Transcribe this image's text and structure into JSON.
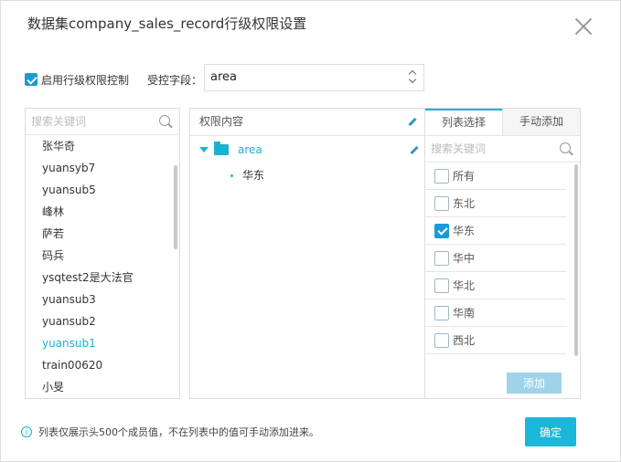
{
  "dialog": {
    "title": "数据集company_sales_record行级权限设置"
  },
  "controls": {
    "enable_label": "启用行级权限控制",
    "enable_checked": true,
    "field_label": "受控字段：",
    "field_value": "area"
  },
  "users": {
    "search_placeholder": "搜索关键词",
    "items": [
      "张华奇",
      "yuansyb7",
      "yuansub5",
      "峰林",
      "萨若",
      "码兵",
      "ysqtest2是大法官",
      "yuansub3",
      "yuansub2",
      "yuansub1",
      "train00620",
      "小旻"
    ],
    "selected": "yuansub1"
  },
  "permissions": {
    "header": "权限内容",
    "tree_root": "area",
    "tree_children": [
      "华东"
    ]
  },
  "selector": {
    "tabs": [
      "列表选择",
      "手动添加"
    ],
    "active_tab": "列表选择",
    "search_placeholder": "搜索关键词",
    "options": [
      {
        "label": "所有",
        "checked": false
      },
      {
        "label": "东北",
        "checked": false
      },
      {
        "label": "华东",
        "checked": true
      },
      {
        "label": "华中",
        "checked": false
      },
      {
        "label": "华北",
        "checked": false
      },
      {
        "label": "华南",
        "checked": false
      },
      {
        "label": "西北",
        "checked": false
      }
    ],
    "add_label": "添加"
  },
  "footer": {
    "note": "列表仅展示头500个成员值，不在列表中的值可手动添加进来。",
    "ok_label": "确定"
  },
  "colors": {
    "accent": "#1ab2d1",
    "add_button": "#9fd3ea"
  }
}
